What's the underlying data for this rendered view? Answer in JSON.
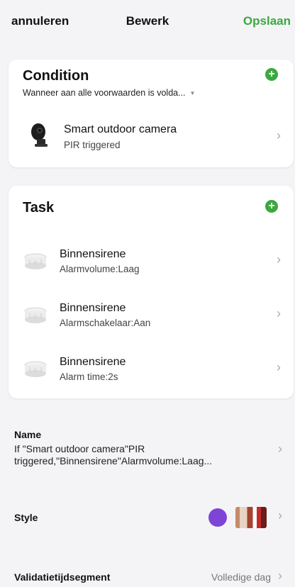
{
  "header": {
    "cancel": "annuleren",
    "title": "Bewerk",
    "save": "Opslaan"
  },
  "condition": {
    "title": "Condition",
    "mode": "Wanneer aan alle voorwaarden is volda...",
    "items": [
      {
        "title": "Smart outdoor camera",
        "sub": "PIR triggered",
        "icon": "camera-icon"
      }
    ]
  },
  "task": {
    "title": "Task",
    "items": [
      {
        "title": "Binnensirene",
        "sub": "Alarmvolume:Laag",
        "icon": "siren-icon"
      },
      {
        "title": "Binnensirene",
        "sub": "Alarmschakelaar:Aan",
        "icon": "siren-icon"
      },
      {
        "title": "Binnensirene",
        "sub": "Alarm time:2s",
        "icon": "siren-icon"
      }
    ]
  },
  "name": {
    "label": "Name",
    "value": "If \"Smart outdoor camera\"PIR triggered,\"Binnensirene\"Alarmvolume:Laag..."
  },
  "style": {
    "label": "Style",
    "color": "#7e44d6"
  },
  "validity": {
    "label": "Validatietijdsegment",
    "value": "Volledige dag"
  },
  "colors": {
    "accent": "#3aa83f",
    "background": "#f4f4f6"
  }
}
